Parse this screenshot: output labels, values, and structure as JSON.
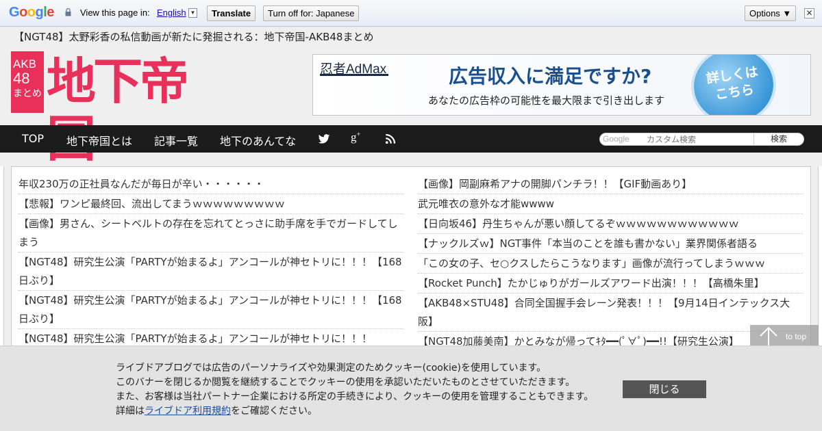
{
  "translate_bar": {
    "logo": [
      "G",
      "o",
      "o",
      "g",
      "l",
      "e"
    ],
    "logo_colors": [
      "#4285f4",
      "#ea4335",
      "#fbbc05",
      "#4285f4",
      "#34a853",
      "#ea4335"
    ],
    "view_label": "View this page in:",
    "language": "English",
    "translate_label": "Translate",
    "turn_off_label": "Turn off for: Japanese",
    "options_label": "Options ▼",
    "close_glyph": "✕"
  },
  "header": {
    "site_title": "【NGT48】太野彩香の私信動画が新たに発掘される：地下帝国-AKB48まとめ",
    "logo_box": [
      "AKB",
      "48",
      "まとめ"
    ],
    "logo_text": "地下帝国",
    "brand_color": "#e8305a"
  },
  "ad": {
    "brand": "忍者AdMax",
    "headline": "広告収入に満足ですか?",
    "sub": "あなたの広告枠の可能性を最大限まで引き出します",
    "cta": [
      "詳しくは",
      "こちら"
    ]
  },
  "nav": {
    "items": [
      "TOP",
      "地下帝国とは",
      "記事一覧",
      "地下のあんてな"
    ],
    "icons": [
      "twitter-icon",
      "google-plus-icon",
      "rss-icon"
    ],
    "search_brand": "Google",
    "search_placeholder": "カスタム検索",
    "search_button": "検索"
  },
  "articles": {
    "left": [
      "年収230万の正社員なんだが毎日が辛い・・・・・・",
      "【悲報】ワンピ最終回、流出してまうｗｗｗｗｗｗｗｗｗ",
      "【画像】男さん、シートベルトの存在を忘れてとっさに助手席を手でガードしてしまう",
      "【NGT48】研究生公演「PARTYが始まるよ」アンコールが神セトリに！！！【168日ぶり】",
      "【NGT48】研究生公演「PARTYが始まるよ」アンコールが神セトリに！！！【168日ぶり】",
      "【NGT48】研究生公演「PARTYが始まるよ」アンコールが神セトリに！！！"
    ],
    "right": [
      "【画像】岡副麻希アナの開脚パンチラ！！【GIF動画あり】",
      "武元唯衣の意外な才能wwww",
      "【日向坂46】丹生ちゃんが悪い顔してるぞｗｗｗｗｗｗｗｗｗｗｗｗ",
      "【ナックルズｗ】NGT事件「本当のことを誰も書かない」業界関係者語る",
      "「この女の子、セ○クスしたらこうなります」画像が流行ってしまうｗｗｗ",
      "【Rocket Punch】たかじゅりがガールズアワード出演！！！【高橋朱里】",
      "【AKB48×STU48】合同全国握手会レーン発表！！！【9月14日インテックス大阪】",
      "【NGT48加藤美南】かとみなが帰ってｷﾀ━━(ﾟ∀ﾟ)━━!!【研究生公演】"
    ]
  },
  "totop": {
    "label": "to top"
  },
  "cookie": {
    "lines": [
      "ライブドアブログでは広告のパーソナライズや効果測定のためクッキー(cookie)を使用しています。",
      "このバナーを閉じるか閲覧を継続することでクッキーの使用を承認いただいたものとさせていただきます。",
      "また、お客様は当社パートナー企業における所定の手続きにより、クッキーの使用を管理することもできます。"
    ],
    "detail_prefix": "詳細は",
    "detail_link": "ライブドア利用規約",
    "detail_suffix": "をご確認ください。",
    "close_label": "閉じる"
  }
}
